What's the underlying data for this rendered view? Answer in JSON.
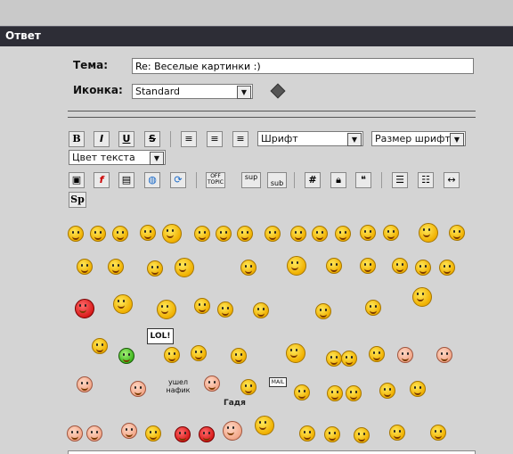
{
  "window": {
    "title": "Ответ"
  },
  "form": {
    "subject_label": "Тема:",
    "subject_value": "Re: Веселые картинки :)",
    "icon_label": "Иконка:",
    "icon_value": "Standard"
  },
  "toolbar": {
    "font_select": "Шрифт",
    "size_select": "Размер шрифта",
    "color_select": "Цвет текста",
    "bold": "B",
    "italic": "I",
    "underline": "U",
    "strike": "S",
    "offtopic": "OFF TOPIC",
    "sup": "sup",
    "sub": "sub",
    "hash": "#",
    "sp": "Sp"
  },
  "smilies": {
    "lol_sign": "LOL!",
    "ushel_sign": "ушел нафик",
    "mail_sign": "MAIL",
    "gadya_label": "Гадя"
  },
  "colors": {
    "titlebar": "#2d2d36",
    "panel": "#d4d4d4",
    "smiley": "#f0b000"
  },
  "icons": [
    "bold-icon",
    "italic-icon",
    "underline-icon",
    "strike-icon",
    "align-left-icon",
    "align-center-icon",
    "align-right-icon",
    "image-icon",
    "flash-icon",
    "picture-icon",
    "globe-icon",
    "refresh-icon",
    "offtopic-icon",
    "sup-icon",
    "sub-icon",
    "hash-icon",
    "lock-icon",
    "quote-icon",
    "list-icon",
    "numbered-list-icon",
    "hr-icon",
    "spoiler-icon"
  ]
}
